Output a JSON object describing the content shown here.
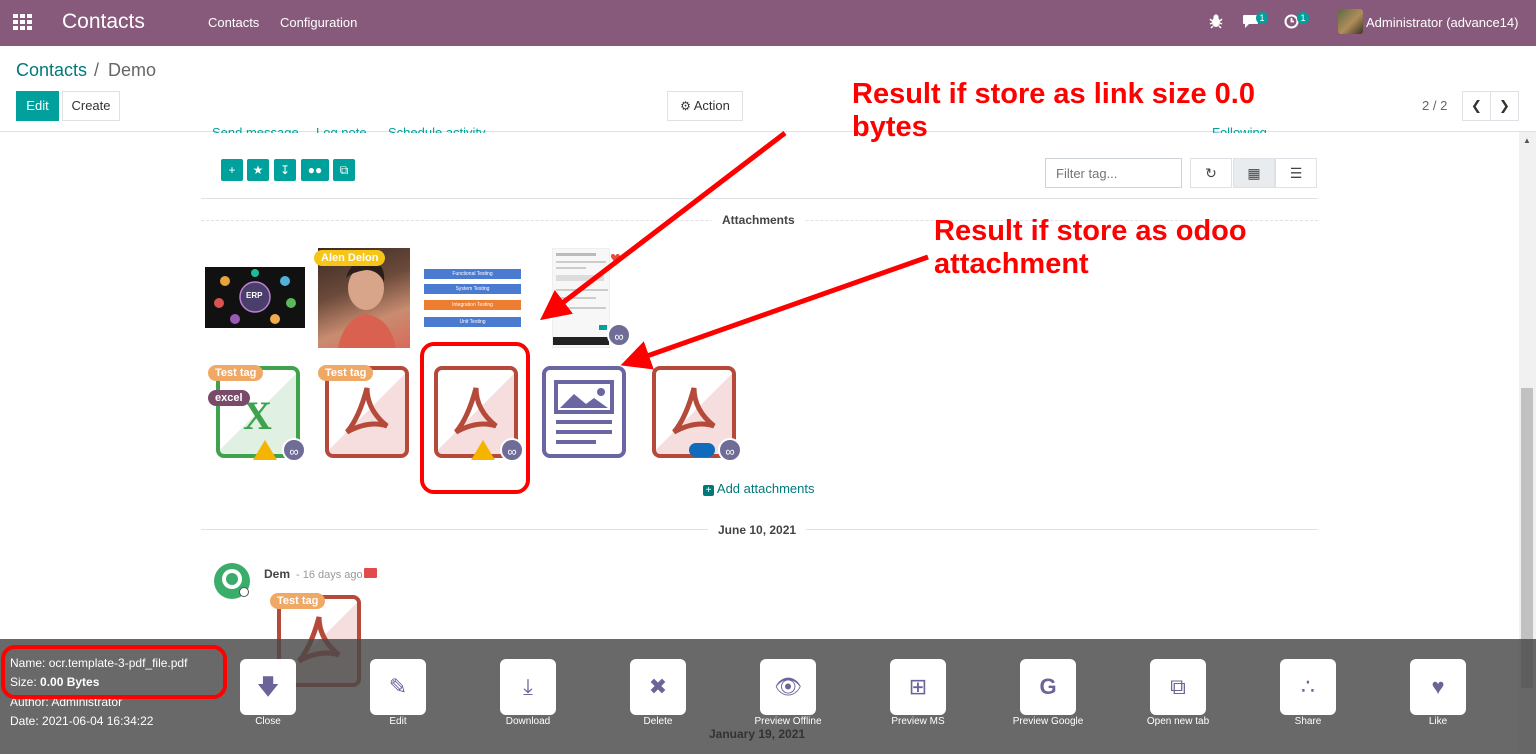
{
  "navbar": {
    "brand": "Contacts",
    "menu": [
      "Contacts",
      "Configuration"
    ],
    "messages_count": "1",
    "activities_count": "1",
    "user": "Administrator (advance14)"
  },
  "control_panel": {
    "breadcrumb_root": "Contacts",
    "breadcrumb_sep": "/",
    "breadcrumb_current": "Demo",
    "edit_label": "Edit",
    "create_label": "Create",
    "action_label": "Action",
    "pager": "2 / 2"
  },
  "chatter": {
    "send_message": "Send message",
    "log_note": "Log note",
    "schedule_activity": "Schedule activity",
    "following": "Following",
    "filter_placeholder": "Filter tag...",
    "attachments_label": "Attachments",
    "add_attachments": "Add attachments",
    "date_1": "June 10, 2021",
    "date_2": "January 19, 2021",
    "message": {
      "author": "Dem",
      "time": "- 16 days ago",
      "tag": "Test tag"
    }
  },
  "attachments": {
    "alen_delon_tag": "Alen Delon",
    "erp_label": "ERP",
    "test_tag": "Test tag",
    "excel_tag": "excel",
    "flow_steps": [
      "Functional Testing",
      "System Testing",
      "Integration Testing",
      "Unit Testing"
    ]
  },
  "annotations": {
    "link_result": "Result if store as link size 0.0 bytes",
    "odoo_result": "Result if store as odoo attachment"
  },
  "preview": {
    "name_label": "Name:",
    "name_value": "ocr.template-3-pdf_file.pdf",
    "size_label": "Size:",
    "size_value": "0.00 Bytes",
    "author_label": "Author:",
    "author_value": "Administrator",
    "date_label": "Date:",
    "date_value": "2021-06-04 16:34:22",
    "buttons": [
      "Close",
      "Edit",
      "Download",
      "Delete",
      "Preview Offline",
      "Preview MS",
      "Preview Google",
      "Open new tab",
      "Share",
      "Like"
    ]
  },
  "colors": {
    "navbar": "#875a7b",
    "primary": "#00a09d",
    "annotation": "#ff0000",
    "pdf": "#b54a3b",
    "link_badge": "#6f6c98"
  }
}
